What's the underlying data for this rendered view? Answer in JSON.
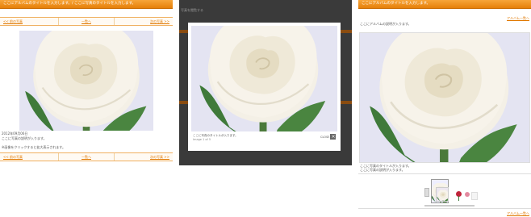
{
  "panel1": {
    "header": "ここにアルバムのタイトルを入力します。/ ここに写真のタイトルを入力します。",
    "nav": {
      "prev": "<< 前の写真",
      "list": "一覧へ",
      "next": "次の写真 >>"
    },
    "date": "2012年09月06日",
    "caption": "ここに写真の説明が入ります。",
    "note": "※画像をクリックすると拡大表示されます。"
  },
  "panel2": {
    "bg_text": "写真を閲覧する",
    "lb_caption": "ここに写真のタイトルが入ります。",
    "lb_counter": "Image 1 of 5",
    "close_label": "CLOSE"
  },
  "panel3": {
    "header": "ここにアルバムのタイトルを入力します。",
    "top_link": "アルバム一覧へ",
    "desc": "ここにアルバムの説明が入ります。",
    "caption1": "ここに写真のタイトルが入ります。",
    "caption2": "ここに写真の説明が入ります。",
    "bottom_link": "アルバム一覧へ"
  },
  "colors": {
    "accent": "#e6800a",
    "overlay": "#3a3a3a",
    "photo_bg": "#e4e4f2"
  }
}
